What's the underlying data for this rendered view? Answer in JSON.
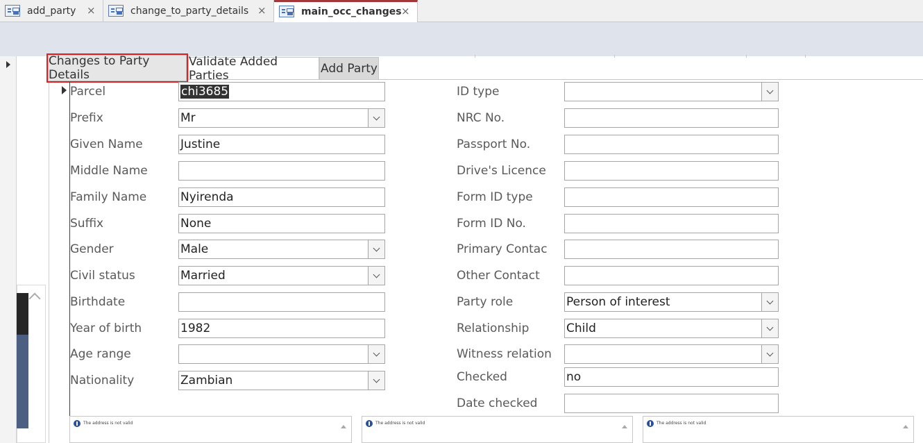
{
  "doc_tabs": [
    {
      "label": "add_party",
      "close": "×",
      "active": false
    },
    {
      "label": "change_to_party_details",
      "close": "×",
      "active": false
    },
    {
      "label": "main_occ_changes",
      "close": "×",
      "active": true
    }
  ],
  "sub_tabs": [
    "Changes to Party Details",
    "Validate Added Parties",
    "Add Party"
  ],
  "left_fields": {
    "parcel": {
      "label": "Parcel",
      "value": "chi3685"
    },
    "prefix": {
      "label": "Prefix",
      "value": "Mr"
    },
    "given_name": {
      "label": "Given Name",
      "value": "Justine"
    },
    "middle_name": {
      "label": "Middle Name",
      "value": ""
    },
    "family_name": {
      "label": "Family Name",
      "value": "Nyirenda"
    },
    "suffix": {
      "label": "Suffix",
      "value": "None"
    },
    "gender": {
      "label": "Gender",
      "value": "Male"
    },
    "civil_status": {
      "label": "Civil status",
      "value": "Married"
    },
    "birthdate": {
      "label": "Birthdate",
      "value": ""
    },
    "year_of_birth": {
      "label": "Year of birth",
      "value": "1982"
    },
    "age_range": {
      "label": "Age range",
      "value": ""
    },
    "nationality": {
      "label": "Nationality",
      "value": "Zambian"
    }
  },
  "right_fields": {
    "id_type": {
      "label": "ID type",
      "value": ""
    },
    "nrc_no": {
      "label": "NRC No.",
      "value": ""
    },
    "passport_no": {
      "label": "Passport No.",
      "value": ""
    },
    "drivers_licence": {
      "label": "Drive's Licence",
      "value": ""
    },
    "form_id_type": {
      "label": "Form ID type",
      "value": ""
    },
    "form_id_no": {
      "label": "Form ID No.",
      "value": ""
    },
    "primary_contact": {
      "label": "Primary Contact",
      "value": ""
    },
    "other_contact": {
      "label": "Other Contact",
      "value": ""
    },
    "party_role": {
      "label": "Party role",
      "value": "Person of interest"
    },
    "relationship": {
      "label": "Relationship",
      "value": "Child"
    },
    "witness_relation": {
      "label": "Witness relation",
      "value": ""
    },
    "checked": {
      "label": "Checked",
      "value": "no"
    },
    "date_checked": {
      "label": "Date checked",
      "value": ""
    }
  },
  "messages": [
    "The address is not valid",
    "The address is not valid",
    "The address is not valid"
  ],
  "colors": {
    "active_tab_accent": "#a4373a",
    "highlight": "#e02020",
    "selection_bg": "#333333"
  }
}
